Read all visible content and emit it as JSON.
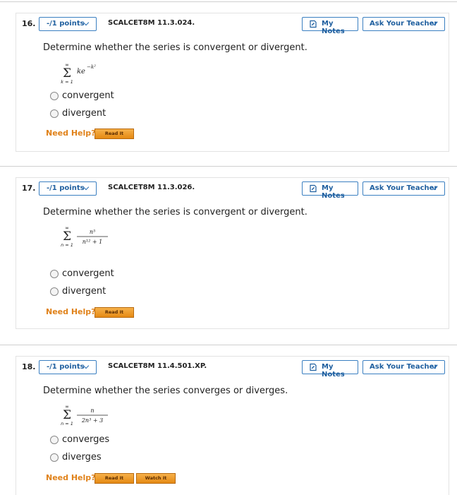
{
  "colors": {
    "accent_blue": "#1f5f9f",
    "help_orange": "#e0821a",
    "button_orange": "#f0a030"
  },
  "questions": [
    {
      "number": "16.",
      "points_label": "-/1 points",
      "code": "SCALCET8M 11.3.024.",
      "my_notes_label": "My Notes",
      "ask_teacher_label": "Ask Your Teacher",
      "prompt": "Determine whether the series is convergent or divergent.",
      "series": {
        "sum_top": "∞",
        "sum_bottom": "k = 1",
        "term": "ke",
        "exponent": "−k²"
      },
      "options": [
        "convergent",
        "divergent"
      ],
      "need_help_label": "Need Help?",
      "help_buttons": [
        "Read It"
      ]
    },
    {
      "number": "17.",
      "points_label": "-/1 points",
      "code": "SCALCET8M 11.3.026.",
      "my_notes_label": "My Notes",
      "ask_teacher_label": "Ask Your Teacher",
      "prompt": "Determine whether the series is convergent or divergent.",
      "series": {
        "sum_top": "∞",
        "sum_bottom": "n = 1",
        "numerator": "n⁵",
        "denominator": "n¹² + 1"
      },
      "options": [
        "convergent",
        "divergent"
      ],
      "need_help_label": "Need Help?",
      "help_buttons": [
        "Read It"
      ]
    },
    {
      "number": "18.",
      "points_label": "-/1 points",
      "code": "SCALCET8M 11.4.501.XP.",
      "my_notes_label": "My Notes",
      "ask_teacher_label": "Ask Your Teacher",
      "prompt": "Determine whether the series converges or diverges.",
      "series": {
        "sum_top": "∞",
        "sum_bottom": "n = 1",
        "numerator": "n",
        "denominator": "2n³ + 3"
      },
      "options": [
        "converges",
        "diverges"
      ],
      "need_help_label": "Need Help?",
      "help_buttons": [
        "Read It",
        "Watch It"
      ]
    }
  ]
}
